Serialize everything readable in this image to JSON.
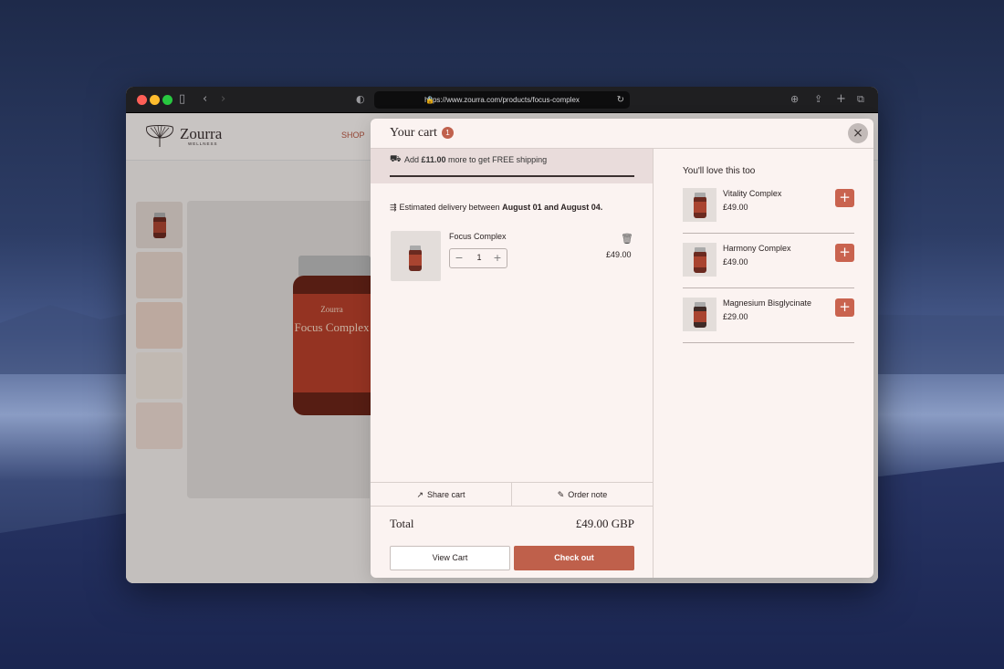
{
  "browser": {
    "url": "https://www.zourra.com/products/focus-complex",
    "icons": {
      "sidebar": "sidebar-icon",
      "back": "chevron-left-icon",
      "forward": "chevron-right-icon",
      "shield": "shield-icon",
      "reload": "reload-icon",
      "download": "download-icon",
      "share": "share-icon",
      "new_tab": "plus-icon",
      "tabs": "tabs-overview-icon"
    }
  },
  "site": {
    "logo": "Zourra",
    "logo_sub": "WELLNESS",
    "nav_shop": "SHOP",
    "product_jar": {
      "brand": "Zourra",
      "name": "Focus Complex"
    }
  },
  "cart": {
    "title": "Your cart",
    "count": "1",
    "close_icon": "close-icon",
    "shipping": {
      "pre": "Add ",
      "amount": "£11.00",
      "post": " more to get FREE shipping"
    },
    "delivery": {
      "pre": "Estimated delivery between ",
      "range": "August 01 and August 04."
    },
    "items": [
      {
        "name": "Focus Complex",
        "quantity": "1",
        "price": "£49.00"
      }
    ],
    "share_label": "Share cart",
    "note_label": "Order note",
    "total_label": "Total",
    "total_value": "£49.00 GBP",
    "view_cart": "View Cart",
    "checkout": "Check out"
  },
  "recommendations": {
    "title": "You'll love this too",
    "items": [
      {
        "name": "Vitality Complex",
        "price": "£49.00"
      },
      {
        "name": "Harmony Complex",
        "price": "£49.00"
      },
      {
        "name": "Magnesium Bisglycinate",
        "price": "£29.00"
      }
    ]
  },
  "colors": {
    "accent": "#bf604b",
    "cart_bg": "#fbf3f1",
    "ship_bg": "#e9dcdb"
  }
}
